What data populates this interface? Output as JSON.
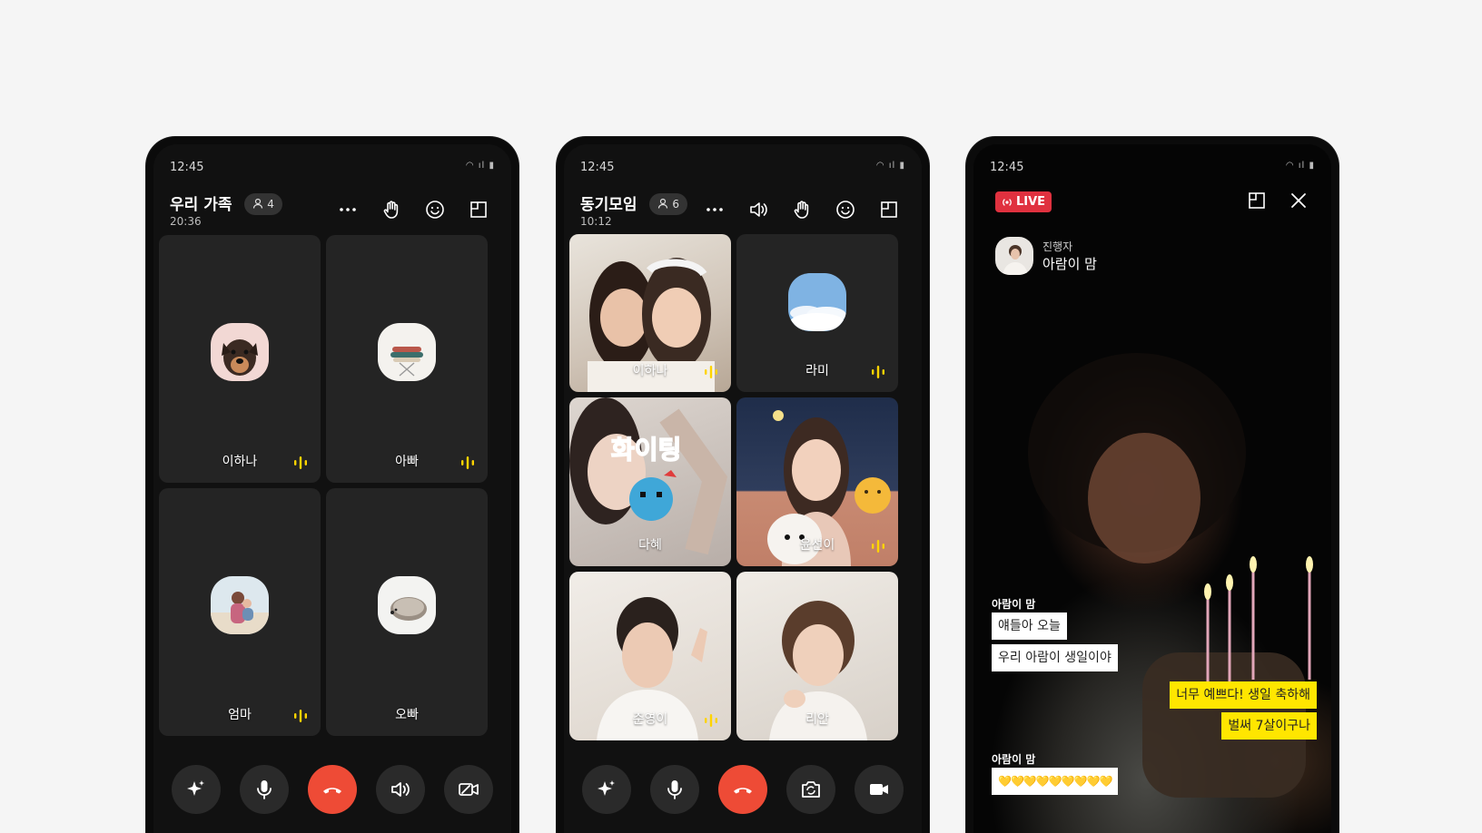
{
  "colors": {
    "accent_yellow": "#ffd400",
    "end_call": "#ee4b36",
    "live_red": "#e0313f"
  },
  "phone1": {
    "status_time": "12:45",
    "title": "우리 가족",
    "participant_count": "4",
    "duration": "20:36",
    "header_icons": [
      "more-icon",
      "raise-hand-icon",
      "emoji-icon",
      "layout-icon"
    ],
    "tiles": [
      {
        "name": "이하나",
        "speaking": true
      },
      {
        "name": "아빠",
        "speaking": true
      },
      {
        "name": "엄마",
        "speaking": true
      },
      {
        "name": "오빠",
        "speaking": false
      }
    ],
    "controls": [
      "ai-sparkle-icon",
      "microphone-icon",
      "end-call-icon",
      "speaker-icon",
      "video-off-icon"
    ]
  },
  "phone2": {
    "status_time": "12:45",
    "title": "동기모임",
    "participant_count": "6",
    "duration": "10:12",
    "header_icons": [
      "more-icon",
      "speaker-icon",
      "raise-hand-icon",
      "emoji-icon",
      "layout-icon"
    ],
    "tiles": [
      {
        "name": "이하나",
        "speaking": true
      },
      {
        "name": "라미",
        "speaking": true
      },
      {
        "name": "다혜",
        "speaking": false
      },
      {
        "name": "윤선이",
        "speaking": true
      },
      {
        "name": "준영이",
        "speaking": true
      },
      {
        "name": "리안",
        "speaking": false
      }
    ],
    "sticker_text": "화이팅",
    "controls": [
      "ai-sparkle-icon",
      "microphone-icon",
      "end-call-icon",
      "camera-switch-icon",
      "video-icon"
    ]
  },
  "phone3": {
    "status_time": "12:45",
    "live_label": "LIVE",
    "host_role": "진행자",
    "host_name": "아람이 맘",
    "chat": {
      "sender1": "아람이 맘",
      "msg1": "얘들아 오늘",
      "msg2": "우리 아람이 생일이야",
      "reply1": "너무 예쁘다! 생일 축하해",
      "reply2": "벌써 7살이구나",
      "sender2": "아람이 맘",
      "msg3": "💛💛💛💛💛💛💛💛💛"
    }
  }
}
